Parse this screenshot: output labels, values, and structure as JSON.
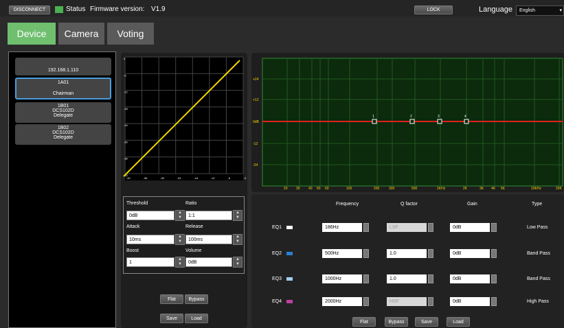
{
  "topbar": {
    "disconnect": "DISCONNECT",
    "status": "Status",
    "firmware": "Firmware version:",
    "version": "V1.9",
    "lock": "LOCK",
    "language_label": "Language",
    "language_value": "English",
    "status_color": "#4caf50"
  },
  "tabs": [
    "Device",
    "Camera",
    "Voting"
  ],
  "devices": [
    {
      "line1": "192.168.1.110"
    },
    {
      "line1": "1A01",
      "line3": "Chairman"
    },
    {
      "line1": "1B01",
      "line2": "DCS102D",
      "line3": "Delegate"
    },
    {
      "line1": "1B02",
      "line2": "DCS102D",
      "line3": "Delegate"
    }
  ],
  "comp_graph": {
    "y_ticks": [
      "0",
      "-6",
      "-12",
      "-18",
      "-24",
      "-30",
      "-36",
      "-42"
    ],
    "x_ticks": [
      "-42",
      "-36",
      "-30",
      "-24",
      "-18",
      "-12",
      "-6",
      "0"
    ]
  },
  "compressor": {
    "threshold_label": "Threshold",
    "threshold": "0dB",
    "ratio_label": "Ratio",
    "ratio": "1:1",
    "attack_label": "Attack",
    "attack": "10ms",
    "release_label": "Release",
    "release": "100ms",
    "boost_label": "Boost",
    "boost": "1",
    "volume_label": "Volume",
    "volume": "0dB",
    "flat": "Flat",
    "bypass": "Bypass",
    "save": "Save",
    "load": "Load"
  },
  "eq_graph": {
    "y_ticks": [
      "+24",
      "+12",
      "0dB",
      "-12",
      "-24"
    ],
    "x_ticks": [
      "20",
      "30",
      "40",
      "50",
      "60",
      "100",
      "200",
      "300",
      "500",
      "1KHz",
      "2K",
      "3K",
      "4K",
      "5K",
      "10KHz",
      "20K"
    ],
    "points": [
      "1",
      "2",
      "3",
      "4"
    ]
  },
  "eq": {
    "headers": [
      "Frequency",
      "Q factor",
      "Gain",
      "Type"
    ],
    "rows": [
      {
        "name": "EQ1",
        "color": "#ffffff",
        "freq": "186Hz",
        "q": "LSF",
        "q_disabled": true,
        "gain": "0dB",
        "type": "Low Pass"
      },
      {
        "name": "EQ2",
        "color": "#2a7fd4",
        "freq": "500Hz",
        "q": "1.0",
        "q_disabled": false,
        "gain": "0dB",
        "type": "Band Pass"
      },
      {
        "name": "EQ3",
        "color": "#9fd0f0",
        "freq": "1000Hz",
        "q": "1.0",
        "q_disabled": false,
        "gain": "0dB",
        "type": "Band Pass"
      },
      {
        "name": "EQ4",
        "color": "#c040a0",
        "freq": "2000Hz",
        "q": "HSF",
        "q_disabled": true,
        "gain": "0dB",
        "type": "High Pass"
      }
    ],
    "flat": "Flat",
    "bypass": "Bypass",
    "save": "Save",
    "load": "Load"
  }
}
